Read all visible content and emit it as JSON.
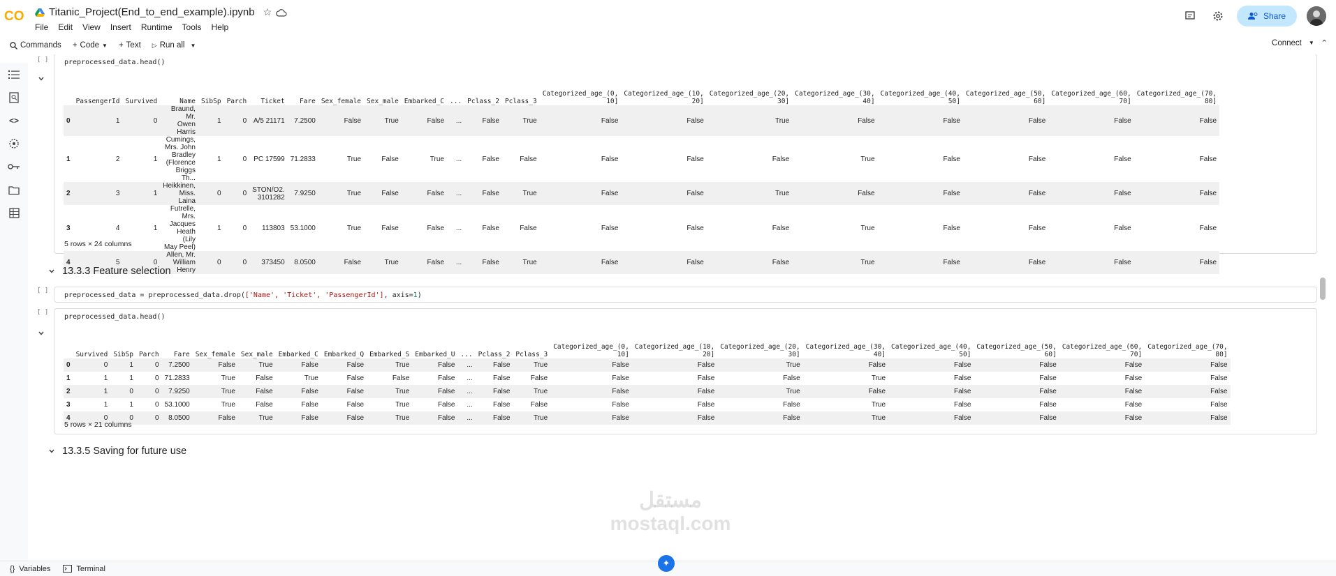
{
  "header": {
    "title": "Titanic_Project(End_to_end_example).ipynb",
    "menus": [
      "File",
      "Edit",
      "View",
      "Insert",
      "Runtime",
      "Tools",
      "Help"
    ],
    "share_label": "Share",
    "logo_text": "CO"
  },
  "toolbar": {
    "commands": "Commands",
    "code": "Code",
    "text": "Text",
    "run_all": "Run all",
    "connect": "Connect"
  },
  "cells": {
    "c1": {
      "gutter": "[ ]",
      "code": "preprocessed_data.head()"
    },
    "c2": {
      "gutter": "[ ]",
      "code_prefix": "preprocessed_data = preprocessed_data.drop(",
      "code_list": "['Name', 'Ticket', 'PassengerId']",
      "code_mid": ", axis=",
      "code_num": "1",
      "code_end": ")"
    },
    "c3": {
      "gutter": "[ ]",
      "code": "preprocessed_data.head()"
    }
  },
  "table1": {
    "columns": [
      "",
      "PassengerId",
      "Survived",
      "Name",
      "SibSp",
      "Parch",
      "Ticket",
      "Fare",
      "Sex_female",
      "Sex_male",
      "Embarked_C",
      "...",
      "Pclass_2",
      "Pclass_3",
      "Categorized_age_(0,\n10]",
      "Categorized_age_(10,\n20]",
      "Categorized_age_(20,\n30]",
      "Categorized_age_(30,\n40]",
      "Categorized_age_(40,\n50]",
      "Categorized_age_(50,\n60]",
      "Categorized_age_(60,\n70]",
      "Categorized_age_(70,\n80]"
    ],
    "rows": [
      [
        "0",
        "1",
        "0",
        "Braund, Mr.\nOwen Harris",
        "1",
        "0",
        "A/5 21171",
        "7.2500",
        "False",
        "True",
        "False",
        "...",
        "False",
        "True",
        "False",
        "False",
        "True",
        "False",
        "False",
        "False",
        "False",
        "False"
      ],
      [
        "1",
        "2",
        "1",
        "Cumings,\nMrs. John\nBradley\n(Florence\nBriggs Th...",
        "1",
        "0",
        "PC 17599",
        "71.2833",
        "True",
        "False",
        "True",
        "...",
        "False",
        "False",
        "False",
        "False",
        "False",
        "True",
        "False",
        "False",
        "False",
        "False"
      ],
      [
        "2",
        "3",
        "1",
        "Heikkinen,\nMiss. Laina",
        "0",
        "0",
        "STON/O2.\n3101282",
        "7.9250",
        "True",
        "False",
        "False",
        "...",
        "False",
        "True",
        "False",
        "False",
        "True",
        "False",
        "False",
        "False",
        "False",
        "False"
      ],
      [
        "3",
        "4",
        "1",
        "Futrelle, Mrs.\nJacques\nHeath (Lily\nMay Peel)",
        "1",
        "0",
        "113803",
        "53.1000",
        "True",
        "False",
        "False",
        "...",
        "False",
        "False",
        "False",
        "False",
        "False",
        "True",
        "False",
        "False",
        "False",
        "False"
      ],
      [
        "4",
        "5",
        "0",
        "Allen, Mr.\nWilliam Henry",
        "0",
        "0",
        "373450",
        "8.0500",
        "False",
        "True",
        "False",
        "...",
        "False",
        "True",
        "False",
        "False",
        "False",
        "True",
        "False",
        "False",
        "False",
        "False"
      ]
    ],
    "shape": "5 rows × 24 columns"
  },
  "section1": "13.3.3 Feature selection",
  "table2": {
    "columns": [
      "",
      "Survived",
      "SibSp",
      "Parch",
      "Fare",
      "Sex_female",
      "Sex_male",
      "Embarked_C",
      "Embarked_Q",
      "Embarked_S",
      "Embarked_U",
      "...",
      "Pclass_2",
      "Pclass_3",
      "Categorized_age_(0,\n10]",
      "Categorized_age_(10,\n20]",
      "Categorized_age_(20,\n30]",
      "Categorized_age_(30,\n40]",
      "Categorized_age_(40,\n50]",
      "Categorized_age_(50,\n60]",
      "Categorized_age_(60,\n70]",
      "Categorized_age_(70,\n80]"
    ],
    "rows": [
      [
        "0",
        "0",
        "1",
        "0",
        "7.2500",
        "False",
        "True",
        "False",
        "False",
        "True",
        "False",
        "...",
        "False",
        "True",
        "False",
        "False",
        "True",
        "False",
        "False",
        "False",
        "False",
        "False"
      ],
      [
        "1",
        "1",
        "1",
        "0",
        "71.2833",
        "True",
        "False",
        "True",
        "False",
        "False",
        "False",
        "...",
        "False",
        "False",
        "False",
        "False",
        "False",
        "True",
        "False",
        "False",
        "False",
        "False"
      ],
      [
        "2",
        "1",
        "0",
        "0",
        "7.9250",
        "True",
        "False",
        "False",
        "False",
        "True",
        "False",
        "...",
        "False",
        "True",
        "False",
        "False",
        "True",
        "False",
        "False",
        "False",
        "False",
        "False"
      ],
      [
        "3",
        "1",
        "1",
        "0",
        "53.1000",
        "True",
        "False",
        "False",
        "False",
        "True",
        "False",
        "...",
        "False",
        "False",
        "False",
        "False",
        "False",
        "True",
        "False",
        "False",
        "False",
        "False"
      ],
      [
        "4",
        "0",
        "0",
        "0",
        "8.0500",
        "False",
        "True",
        "False",
        "False",
        "True",
        "False",
        "...",
        "False",
        "True",
        "False",
        "False",
        "False",
        "True",
        "False",
        "False",
        "False",
        "False"
      ]
    ],
    "shape": "5 rows × 21 columns"
  },
  "section2": "13.3.5 Saving for future use",
  "bottom": {
    "variables": "Variables",
    "terminal": "Terminal"
  },
  "watermark": {
    "line1": "مستقل",
    "line2": "mostaql.com"
  }
}
